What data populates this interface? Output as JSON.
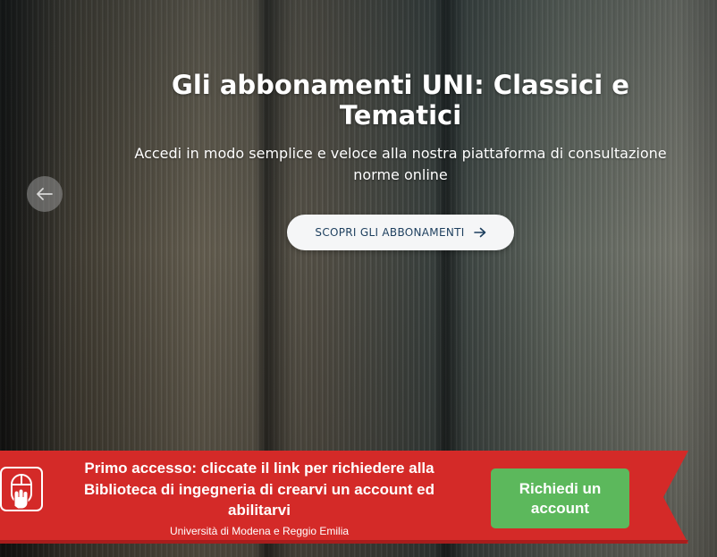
{
  "hero": {
    "title": "Gli abbonamenti UNI: Classici e Tematici",
    "subtitle": "Accedi in modo semplice e veloce alla nostra piattaforma di consultazione norme online",
    "cta_label": "SCOPRI GLI ABBONAMENTI",
    "cta_icon": "arrow-right-icon",
    "prev_icon": "arrow-left-icon"
  },
  "banner": {
    "message": "Primo accesso: cliccate il link per richiedere alla Biblioteca di ingegneria di crearvi un account ed abilitarvi",
    "institution": "Università di Modena e Reggio Emilia",
    "button_label": "Richiedi un account",
    "icon": "mouse-click-icon",
    "colors": {
      "ribbon": "#d42a28",
      "button": "#5cb85c"
    }
  },
  "colors": {
    "cta_text": "#1d3f5e",
    "cta_background": "#f5f6f7"
  }
}
